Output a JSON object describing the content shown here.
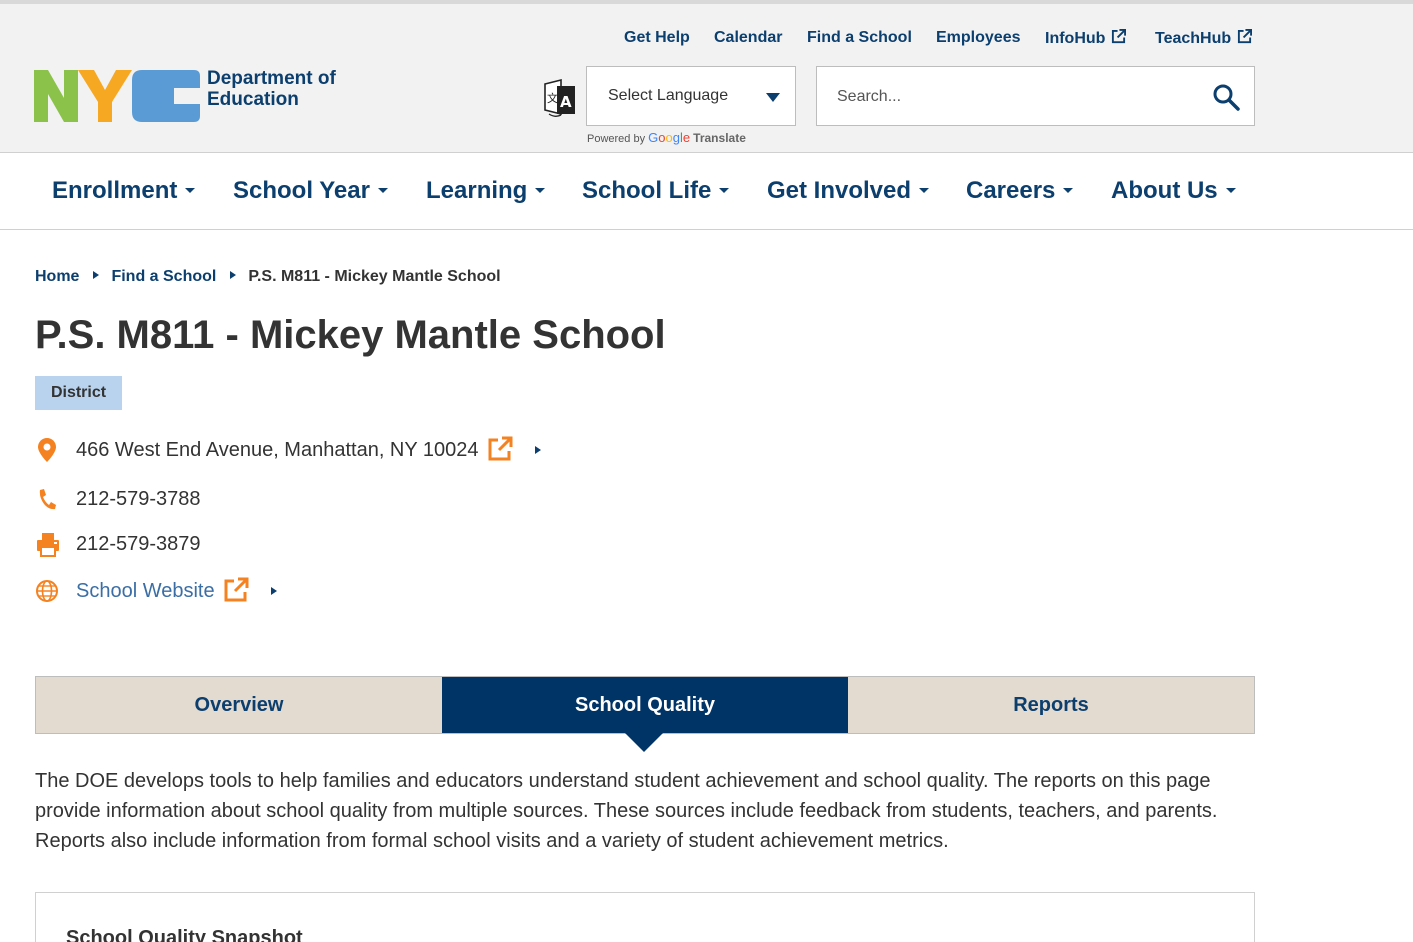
{
  "brand": {
    "logo_text": "NYC",
    "dept_line1": "Department of",
    "dept_line2": "Education",
    "colors": {
      "n_green": "#8bc34a",
      "y_orange": "#f7a823",
      "c_blue": "#5b9bd5",
      "navy": "#0c3f6e",
      "accent_orange": "#f58220"
    }
  },
  "utility_nav": [
    {
      "label": "Get Help"
    },
    {
      "label": "Calendar"
    },
    {
      "label": "Find a School"
    },
    {
      "label": "Employees"
    },
    {
      "label": "InfoHub",
      "external": true
    },
    {
      "label": "TeachHub",
      "external": true
    }
  ],
  "language": {
    "icon": "translate-icon",
    "selected": "Select Language",
    "powered_by": "Powered by",
    "google": [
      "G",
      "o",
      "o",
      "g",
      "l",
      "e"
    ],
    "translate": "Translate"
  },
  "search": {
    "placeholder": "Search..."
  },
  "main_nav": [
    {
      "label": "Enrollment"
    },
    {
      "label": "School Year"
    },
    {
      "label": "Learning"
    },
    {
      "label": "School Life"
    },
    {
      "label": "Get Involved"
    },
    {
      "label": "Careers"
    },
    {
      "label": "About Us"
    }
  ],
  "breadcrumb": {
    "items": [
      {
        "label": "Home"
      },
      {
        "label": "Find a School"
      }
    ],
    "current": "P.S. M811 - Mickey Mantle School"
  },
  "school": {
    "title": "P.S. M811 - Mickey Mantle School",
    "badge": "District",
    "address": "466 West End Avenue, Manhattan, NY 10024",
    "phone": "212-579-3788",
    "fax": "212-579-3879",
    "website_label": "School Website"
  },
  "tabs": [
    {
      "label": "Overview",
      "active": false
    },
    {
      "label": "School Quality",
      "active": true
    },
    {
      "label": "Reports",
      "active": false
    }
  ],
  "intro_text": "The DOE develops tools to help families and educators understand student achievement and school quality. The reports on this page provide information about school quality from multiple sources. These sources include feedback from students, teachers, and parents. Reports also include information from formal school visits and a variety of student achievement metrics.",
  "snapshot": {
    "heading": "School Quality Snapshot"
  }
}
